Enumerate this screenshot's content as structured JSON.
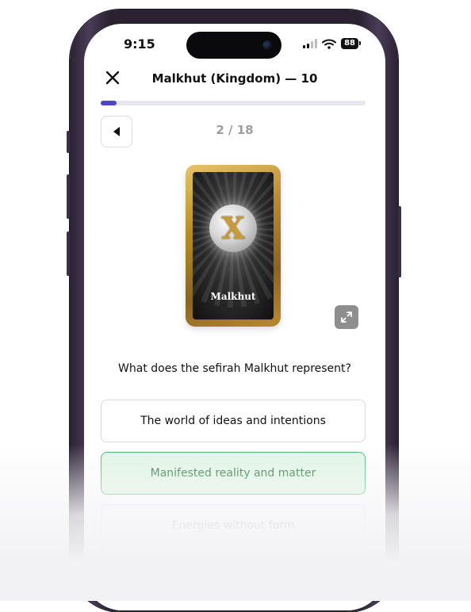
{
  "status_bar": {
    "time": "9:15",
    "battery": "88"
  },
  "header": {
    "title": "Malkhut (Kingdom) — 10"
  },
  "progress": {
    "fraction": 0.06,
    "counter": "2 / 18"
  },
  "card": {
    "name": "Malkhut",
    "symbol": "X"
  },
  "question": {
    "text": "What does the sefirah Malkhut represent?"
  },
  "options": [
    {
      "label": "The world of ideas and intentions",
      "state": "default"
    },
    {
      "label": "Manifested reality and matter",
      "state": "correct"
    },
    {
      "label": "Energies without form",
      "state": "faded"
    }
  ],
  "colors": {
    "accent": "#4d47c8",
    "correct_bg": "#dff6e4",
    "correct_border": "#3fb35d",
    "card_gold": "#b98a2e"
  },
  "icons": {
    "close": "close-icon",
    "back": "back-triangle-icon",
    "expand": "expand-icon",
    "signal": "signal-icon",
    "wifi": "wifi-icon",
    "battery": "battery-icon"
  }
}
